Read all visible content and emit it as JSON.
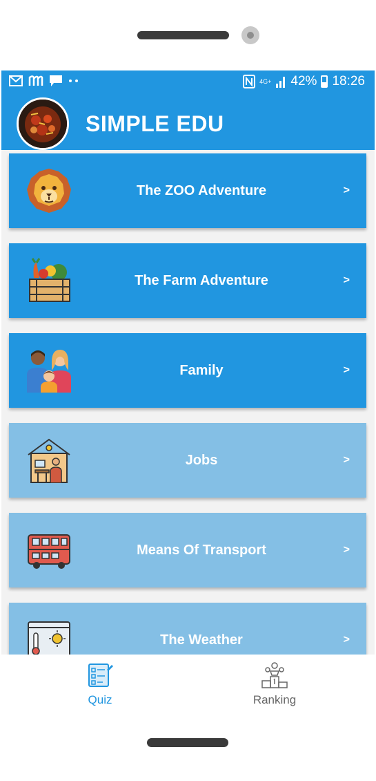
{
  "status_bar": {
    "battery": "42%",
    "time": "18:26",
    "network": "4G+",
    "left_icons": [
      "mail-icon",
      "m-app-icon",
      "chat-icon",
      "more-dots-icon"
    ],
    "right_icons": [
      "nfc-icon",
      "signal-icon",
      "battery-icon"
    ]
  },
  "app": {
    "title": "SIMPLE EDU"
  },
  "items": [
    {
      "label": "The ZOO Adventure",
      "arrow": ">",
      "icon": "lion-icon",
      "enabled": true
    },
    {
      "label": "The Farm Adventure",
      "arrow": ">",
      "icon": "vegetable-crate-icon",
      "enabled": true
    },
    {
      "label": "Family",
      "arrow": ">",
      "icon": "family-icon",
      "enabled": true
    },
    {
      "label": "Jobs",
      "arrow": ">",
      "icon": "house-worker-icon",
      "enabled": false
    },
    {
      "label": "Means Of Transport",
      "arrow": ">",
      "icon": "bus-icon",
      "enabled": false
    },
    {
      "label": "The Weather",
      "arrow": ">",
      "icon": "weather-icon",
      "enabled": false
    }
  ],
  "nav": {
    "quiz": "Quiz",
    "ranking": "Ranking"
  },
  "colors": {
    "primary": "#2196e0",
    "disabled": "#84bfe5",
    "nav_inactive": "#666666"
  }
}
